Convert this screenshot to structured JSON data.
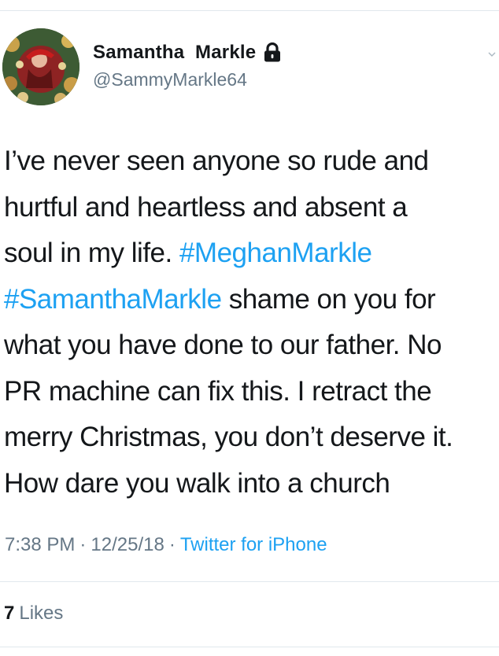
{
  "header": {
    "display_name": "Samantha  Markle",
    "handle": "@SammyMarkle64",
    "avatar_icon": "profile-photo-christmas-wreath",
    "lock_icon": "lock-icon",
    "menu_icon": "chevron-down-icon"
  },
  "tweet": {
    "line1": "I’ve never seen anyone so rude and",
    "line2": "hurtful and heartless and absent a",
    "line3_text": "soul in my life. ",
    "line3_hashtag": "#MeghanMarkle",
    "line4_hashtag": "#SamanthaMarkle",
    "line4_text": " shame on you for",
    "line5": "what you have done to our father. No",
    "line6": "PR machine can fix this. I retract the",
    "line7": "merry Christmas, you don’t deserve it.",
    "line8": "How dare you walk into a church"
  },
  "meta": {
    "time": "7:38 PM",
    "separator1": "·",
    "date": "12/25/18",
    "separator2": "·",
    "source": "Twitter for iPhone"
  },
  "stats": {
    "likes_count": "7",
    "likes_label": "Likes"
  },
  "colors": {
    "link": "#1da1f2",
    "secondary_text": "#657786",
    "primary_text": "#14171a",
    "divider": "#e1e8ed"
  }
}
